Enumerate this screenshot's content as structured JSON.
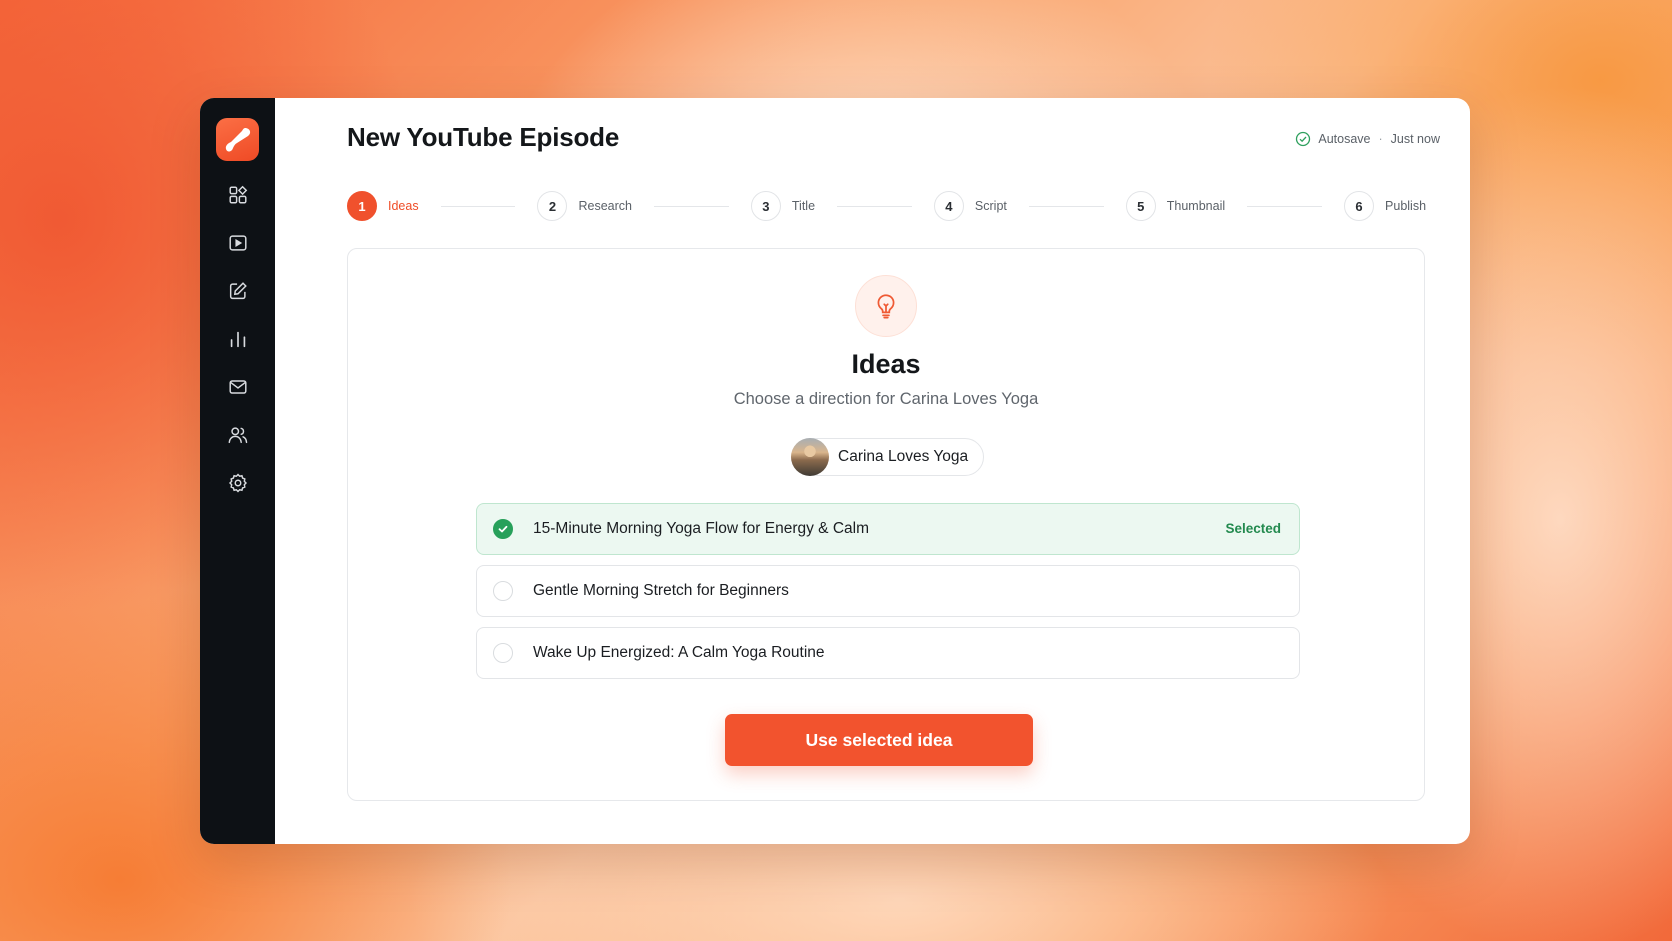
{
  "page": {
    "title": "New YouTube Episode",
    "autosave_label": "Autosave",
    "autosave_separator": "·",
    "autosave_time": "Just now"
  },
  "sidebar": {
    "logo_icon": "brand-logo-icon",
    "items": [
      {
        "icon": "dashboard-icon"
      },
      {
        "icon": "video-icon"
      },
      {
        "icon": "edit-icon"
      },
      {
        "icon": "analytics-icon"
      },
      {
        "icon": "mail-icon"
      },
      {
        "icon": "users-icon"
      },
      {
        "icon": "settings-icon"
      }
    ]
  },
  "stepper": {
    "steps": [
      {
        "number": "1",
        "label": "Ideas",
        "active": true
      },
      {
        "number": "2",
        "label": "Research",
        "active": false
      },
      {
        "number": "3",
        "label": "Title",
        "active": false
      },
      {
        "number": "4",
        "label": "Script",
        "active": false
      },
      {
        "number": "5",
        "label": "Thumbnail",
        "active": false
      },
      {
        "number": "6",
        "label": "Publish",
        "active": false
      }
    ]
  },
  "card": {
    "icon": "lightbulb-icon",
    "title": "Ideas",
    "subtitle": "Choose a direction for Carina Loves Yoga",
    "channel_name": "Carina Loves Yoga",
    "ideas": [
      {
        "text": "15-Minute Morning Yoga Flow for Energy & Calm",
        "selected": true,
        "badge": "Selected"
      },
      {
        "text": "Gentle Morning Stretch for Beginners",
        "selected": false
      },
      {
        "text": "Wake Up Energized: A Calm Yoga Routine",
        "selected": false
      }
    ],
    "cta_label": "Use selected idea"
  },
  "colors": {
    "accent": "#f2532e",
    "sidebar_bg": "#0d1115",
    "selected_bg": "#ecf8f1",
    "success": "#27a05a"
  }
}
